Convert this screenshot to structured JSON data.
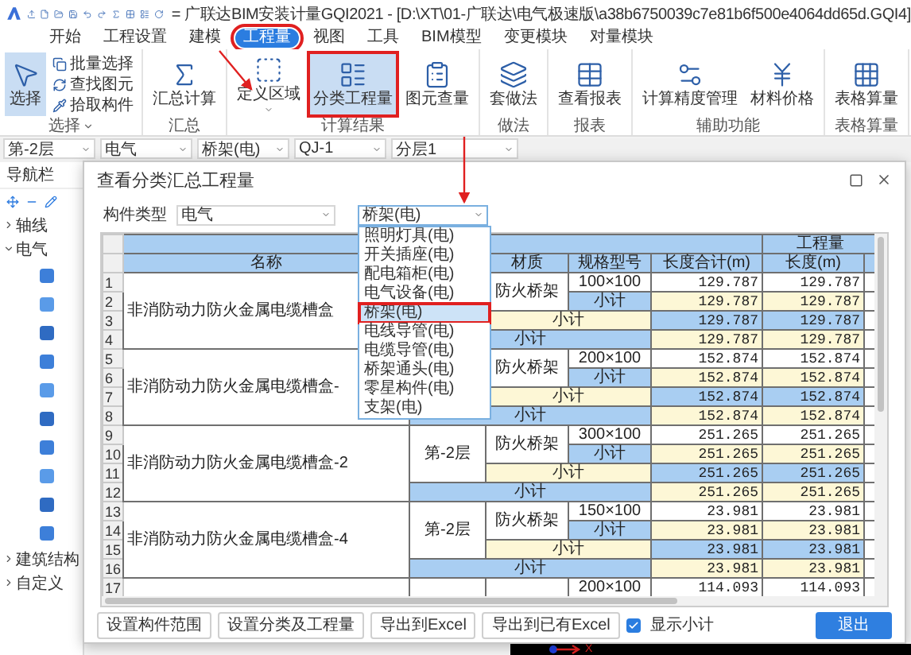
{
  "app": {
    "title": "= 广联达BIM安装计量GQI2021 - [D:\\XT\\01-广联达\\电气极速版\\a38b6750039c7e81b6f500e4064dd65d.GQI4]"
  },
  "menu_tabs": [
    {
      "label": "开始",
      "selected": false,
      "annotated": false
    },
    {
      "label": "工程设置",
      "selected": false,
      "annotated": false
    },
    {
      "label": "建模",
      "selected": false,
      "annotated": false
    },
    {
      "label": "工程量",
      "selected": true,
      "annotated": true
    },
    {
      "label": "视图",
      "selected": false,
      "annotated": false
    },
    {
      "label": "工具",
      "selected": false,
      "annotated": false
    },
    {
      "label": "BIM模型",
      "selected": false,
      "annotated": false
    },
    {
      "label": "变更模块",
      "selected": false,
      "annotated": false
    },
    {
      "label": "对量模块",
      "selected": false,
      "annotated": false
    }
  ],
  "ribbon": [
    {
      "label": "选择",
      "has_menu": true,
      "items": [
        {
          "kind": "large",
          "label": "选择",
          "selected": true,
          "annotated": false
        },
        {
          "kind": "small",
          "label": "批量选择"
        },
        {
          "kind": "small",
          "label": "查找图元"
        },
        {
          "kind": "small",
          "label": "拾取构件"
        }
      ]
    },
    {
      "label": "汇总",
      "has_menu": false,
      "items": [
        {
          "kind": "large",
          "label": "汇总计算",
          "selected": false,
          "annotated": false
        }
      ]
    },
    {
      "label": "计算结果",
      "has_menu": false,
      "items": [
        {
          "kind": "large",
          "label": "定义区域",
          "selected": false,
          "annotated": false,
          "has_menu": true
        },
        {
          "kind": "large",
          "label": "分类工程量",
          "selected": true,
          "annotated": true
        },
        {
          "kind": "large",
          "label": "图元查量",
          "selected": false,
          "annotated": false
        }
      ]
    },
    {
      "label": "做法",
      "has_menu": false,
      "items": [
        {
          "kind": "large",
          "label": "套做法",
          "selected": false,
          "annotated": false
        }
      ]
    },
    {
      "label": "报表",
      "has_menu": false,
      "items": [
        {
          "kind": "large",
          "label": "查看报表",
          "selected": false,
          "annotated": false
        }
      ]
    },
    {
      "label": "辅助功能",
      "has_menu": false,
      "items": [
        {
          "kind": "large",
          "label": "计算精度管理",
          "selected": false,
          "annotated": false
        },
        {
          "kind": "large",
          "label": "材料价格",
          "selected": false,
          "annotated": false
        }
      ]
    },
    {
      "label": "表格算量",
      "has_menu": false,
      "items": [
        {
          "kind": "large",
          "label": "表格算量",
          "selected": false,
          "annotated": false
        }
      ]
    }
  ],
  "selectors": [
    "第-2层",
    "电气",
    "桥架(电)",
    "QJ-1",
    "分层1"
  ],
  "navigator": {
    "title": "导航栏",
    "tree": [
      {
        "label": "轴线",
        "expanded": false
      },
      {
        "label": "电气",
        "expanded": true
      },
      {
        "label": "建筑结构",
        "expanded": false
      },
      {
        "label": "自定义",
        "expanded": false
      }
    ]
  },
  "dialog": {
    "title": "查看分类汇总工程量",
    "filter_label": "构件类型",
    "type_value": "电气",
    "component_value": "桥架(电)",
    "dropdown": [
      {
        "label": "照明灯具(电)",
        "selected": false,
        "annotated": false
      },
      {
        "label": "开关插座(电)",
        "selected": false,
        "annotated": false
      },
      {
        "label": "配电箱柜(电)",
        "selected": false,
        "annotated": false
      },
      {
        "label": "电气设备(电)",
        "selected": false,
        "annotated": false
      },
      {
        "label": "桥架(电)",
        "selected": true,
        "annotated": true
      },
      {
        "label": "电线导管(电)",
        "selected": false,
        "annotated": false
      },
      {
        "label": "电缆导管(电)",
        "selected": false,
        "annotated": false
      },
      {
        "label": "桥架通头(电)",
        "selected": false,
        "annotated": false
      },
      {
        "label": "零星构件(电)",
        "selected": false,
        "annotated": false
      },
      {
        "label": "支架(电)",
        "selected": false,
        "annotated": false
      }
    ],
    "table": {
      "group_header": "工程量",
      "columns": {
        "name": "名称",
        "material": "材质",
        "spec": "规格型号",
        "total": "长度合计(m)",
        "length": "长度(m)"
      },
      "groups": [
        {
          "numbers": [
            "1",
            "2",
            "3",
            "4"
          ],
          "name": "非消防动力防火金属电缆槽盒",
          "material": "防火桥架",
          "spec": "100×100",
          "subtotals": [
            "小计",
            "小计",
            "小计"
          ],
          "values": [
            [
              "129.787",
              "129.787"
            ],
            [
              "129.787",
              "129.787"
            ],
            [
              "129.787",
              "129.787"
            ],
            [
              "129.787",
              "129.787"
            ]
          ]
        },
        {
          "numbers": [
            "5",
            "6",
            "7",
            "8"
          ],
          "name": "非消防动力防火金属电缆槽盒-",
          "material": "防火桥架",
          "spec": "200×100",
          "subtotals": [
            "小计",
            "小计",
            "小计"
          ],
          "values": [
            [
              "152.874",
              "152.874"
            ],
            [
              "152.874",
              "152.874"
            ],
            [
              "152.874",
              "152.874"
            ],
            [
              "152.874",
              "152.874"
            ]
          ]
        },
        {
          "numbers": [
            "9",
            "10",
            "11",
            "12"
          ],
          "name": "非消防动力防火金属电缆槽盒-2",
          "floor": "第-2层",
          "material": "防火桥架",
          "spec": "300×100",
          "subtotals": [
            "小计",
            "小计",
            "小计"
          ],
          "values": [
            [
              "251.265",
              "251.265"
            ],
            [
              "251.265",
              "251.265"
            ],
            [
              "251.265",
              "251.265"
            ],
            [
              "251.265",
              "251.265"
            ]
          ]
        },
        {
          "numbers": [
            "13",
            "14",
            "15",
            "16"
          ],
          "name": "非消防动力防火金属电缆槽盒-4",
          "floor": "第-2层",
          "material": "防火桥架",
          "spec": "150×100",
          "subtotals": [
            "小计",
            "小计",
            "小计"
          ],
          "values": [
            [
              "23.981",
              "23.981"
            ],
            [
              "23.981",
              "23.981"
            ],
            [
              "23.981",
              "23.981"
            ],
            [
              "23.981",
              "23.981"
            ]
          ]
        },
        {
          "numbers": [
            "17"
          ],
          "spec": "200×100",
          "values": [
            [
              "114.093",
              "114.093"
            ]
          ]
        }
      ]
    },
    "buttons": [
      "设置构件范围",
      "设置分类及工程量",
      "导出到Excel",
      "导出到已有Excel"
    ],
    "show_subtotal": {
      "label": "显示小计",
      "checked": true
    },
    "exit_button": "退出"
  },
  "canvas": {
    "axis_label": "X"
  }
}
